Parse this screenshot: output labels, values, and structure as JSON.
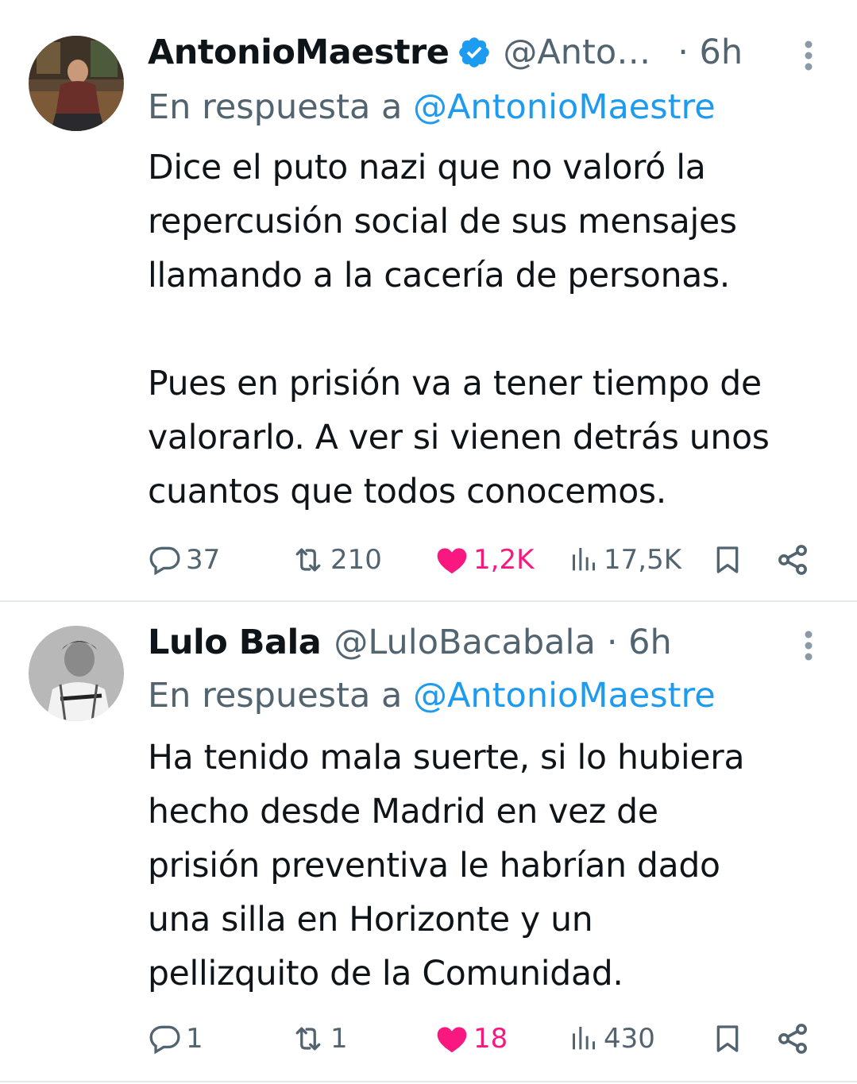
{
  "tweets": [
    {
      "author_name": "AntonioMaestre",
      "handle": "@Anto…",
      "time": "· 6h",
      "verified": true,
      "reply_prefix": "En respuesta a ",
      "reply_mention": "@AntonioMaestre",
      "text": "Dice el puto nazi que no valoró la\nrepercusión social de sus mensajes\nllamando a la cacería de personas.\n\nPues en prisión va a tener tiempo de\nvalorarlo. A ver si vienen detrás unos\ncuantos que todos conocemos.",
      "replies": "37",
      "retweets": "210",
      "likes": "1,2K",
      "views": "17,5K",
      "liked": true
    },
    {
      "author_name": "Lulo Bala",
      "handle": "@LuloBacabala",
      "time": "· 6h",
      "verified": false,
      "reply_prefix": "En respuesta a ",
      "reply_mention": "@AntonioMaestre",
      "text": "Ha tenido mala suerte, si lo hubiera\nhecho desde Madrid en vez de\nprisión preventiva le habrían dado\nuna silla en Horizonte y un\npellizquito de la Comunidad.",
      "replies": "1",
      "retweets": "1",
      "likes": "18",
      "views": "430",
      "liked": true
    }
  ],
  "icons": {
    "reply": "reply-icon",
    "retweet": "retweet-icon",
    "like": "heart-icon",
    "views": "views-icon",
    "bookmark": "bookmark-icon",
    "share": "share-icon",
    "more": "more-vertical-icon",
    "verified": "verified-badge-icon"
  },
  "colors": {
    "text": "#0f1419",
    "secondary": "#536471",
    "link": "#1d9bf0",
    "like": "#f91880",
    "divider": "#e6e9ea"
  }
}
